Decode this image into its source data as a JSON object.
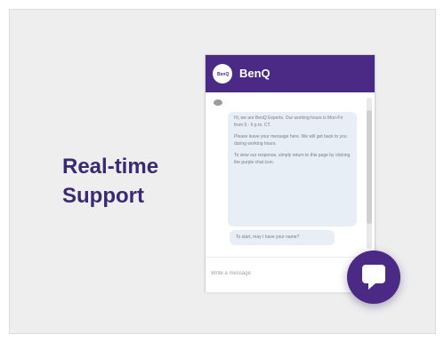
{
  "headline": {
    "line1": "Real-time",
    "line2": "Support",
    "color": "#3b2a73"
  },
  "chat_widget": {
    "brand_name": "BenQ",
    "logo_text": "BenQ",
    "header_color": "#4b2a86",
    "avatar_icon": "agent-avatar-icon",
    "welcome_messages": [
      "Hi, we are BenQ Experts. Our working hours is Mon-Fri from 9 - 6 p.m. CT.",
      "Please leave your message here. We will get back to you during working hours.",
      "To view our response, simply return to this page by clicking the purple chat icon."
    ],
    "name_prompt": "To start, may I have your name?",
    "input_placeholder": "Write a message",
    "launcher_icon": "chat-bubble-icon"
  }
}
